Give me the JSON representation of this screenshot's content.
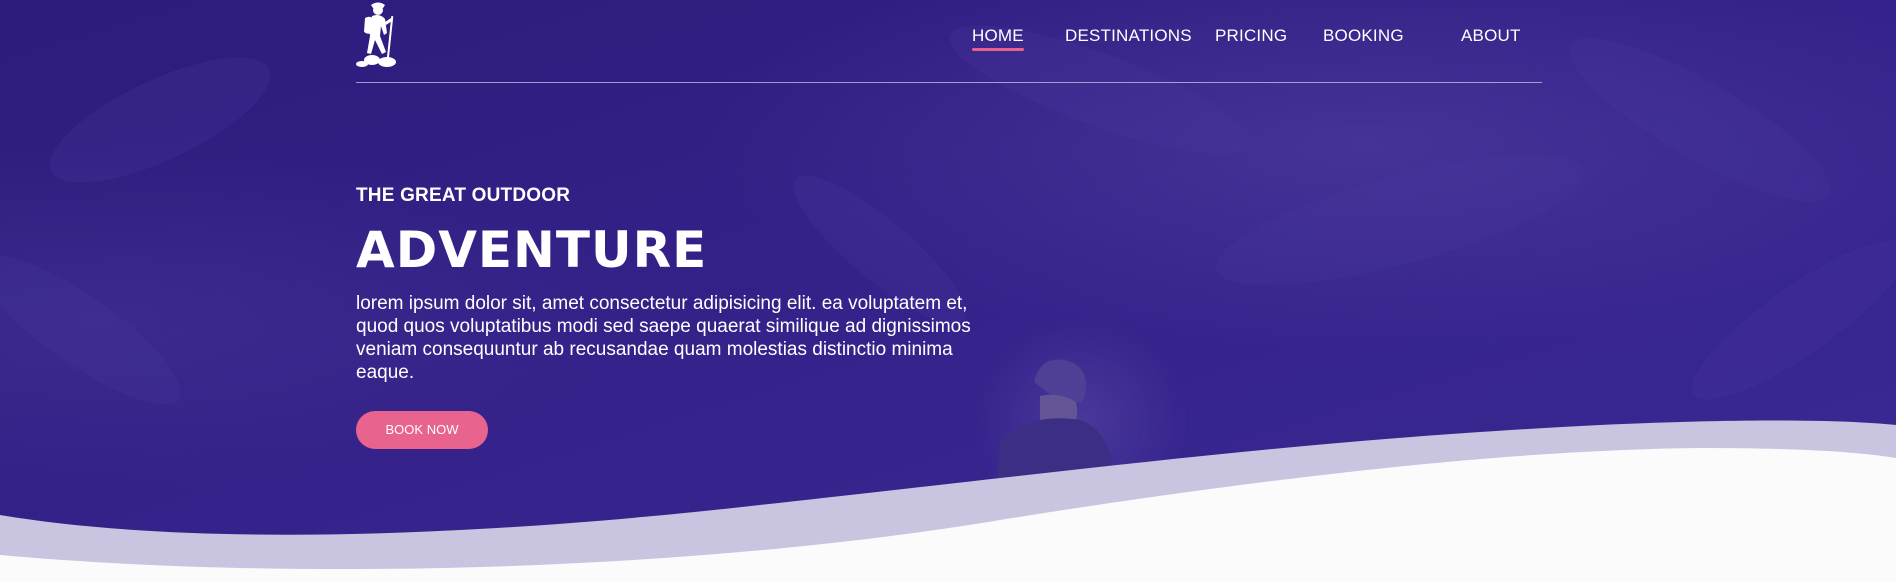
{
  "colors": {
    "hero_overlay": "#2f1d7e",
    "accent_pink": "#e8638d",
    "wave_light": "#c9c4e0",
    "text_white": "#ffffff"
  },
  "logo": {
    "icon": "hiker-icon"
  },
  "nav": {
    "items": [
      {
        "label": "HOME",
        "active": true
      },
      {
        "label": "DESTINATIONS",
        "active": false
      },
      {
        "label": "PRICING",
        "active": false
      },
      {
        "label": "BOOKING",
        "active": false
      },
      {
        "label": "ABOUT",
        "active": false
      }
    ]
  },
  "hero": {
    "eyebrow": "THE GREAT OUTDOOR",
    "title": "ADVENTURE",
    "body": "lorem ipsum dolor sit, amet consectetur adipisicing elit. ea voluptatem et, quod quos voluptatibus modi sed saepe quaerat similique ad dignissimos veniam consequuntur ab recusandae quam molestias distinctio minima eaque.",
    "cta_label": "BOOK NOW"
  }
}
